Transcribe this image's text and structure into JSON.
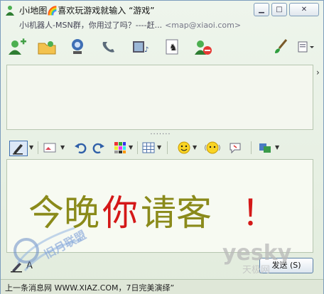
{
  "window": {
    "title": "小i地图🌈喜欢玩游戏就输入 “游戏”",
    "subtitle": "小i机器人-MSN群，你用过了吗？----赶...",
    "email": "<map@xiaoi.com>",
    "buttons": [
      "minimize-icon",
      "maximize-icon",
      "close-icon"
    ]
  },
  "toolbar": {
    "items": [
      "add-contact-icon",
      "folder-icon",
      "webcam-icon",
      "phone-icon",
      "video-icon",
      "game-icon",
      "block-icon",
      "paint-icon",
      "menu-icon"
    ]
  },
  "format_toolbar": {
    "items": [
      "font-icon",
      "background-icon",
      "undo-icon",
      "redo-icon",
      "color-grid-icon",
      "table-icon",
      "emoticon-icon",
      "wink-icon",
      "nudge-icon",
      "voice-clip-icon"
    ]
  },
  "compose": {
    "handwritten_text": "今晚你请客！"
  },
  "send_button_label": "发送 (S)",
  "status_text": "上一条消息网 WWW.XIAZ.COM，7日完美演绎”",
  "watermark": {
    "text": "yesky",
    "sub": "天极网",
    "left_logo": "旧月联盟"
  },
  "colors": {
    "accent": "#7d9dbd",
    "bg": "#e7efe3",
    "ink_olive": "#8a8a1a",
    "ink_red": "#d41818"
  }
}
